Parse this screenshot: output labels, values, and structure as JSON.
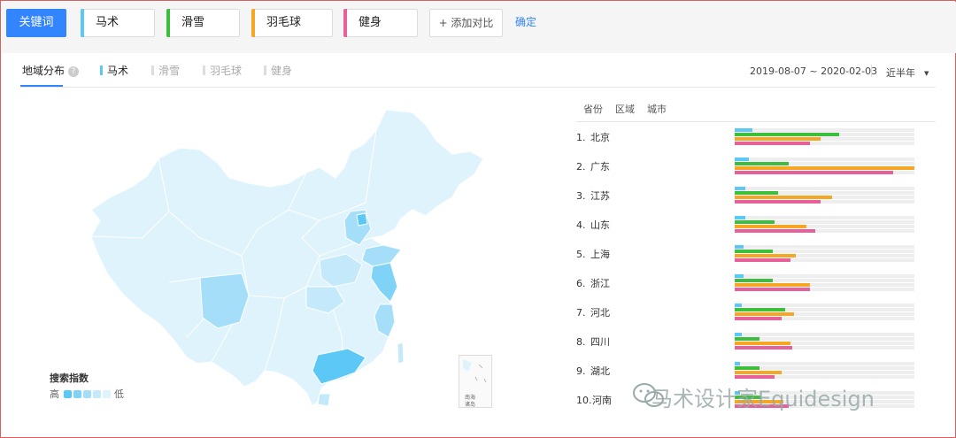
{
  "toolbar": {
    "keywords_label": "关键词",
    "keywords": [
      {
        "label": "马术",
        "color": "#5bc8f5"
      },
      {
        "label": "滑雪",
        "color": "#3cbf3c"
      },
      {
        "label": "羽毛球",
        "color": "#f5a623"
      },
      {
        "label": "健身",
        "color": "#e8609a"
      }
    ],
    "add_label": "+ 添加对比",
    "confirm_label": "确定"
  },
  "header": {
    "main_tab": "地域分布",
    "help_glyph": "?",
    "keyword_tabs": [
      {
        "label": "马术",
        "active": true,
        "color": "#5bc8f5"
      },
      {
        "label": "滑雪",
        "active": false
      },
      {
        "label": "羽毛球",
        "active": false
      },
      {
        "label": "健身",
        "active": false
      }
    ],
    "date_range": "2019-08-07 ~ 2020-02-03",
    "period": "近半年"
  },
  "map": {
    "legend_title": "搜索指数",
    "legend_high": "高",
    "legend_low": "低",
    "legend_colors": [
      "#5bc8f5",
      "#7fd3f7",
      "#a4def9",
      "#c4e9fb",
      "#dff3fd"
    ],
    "inset_label_top": "南海",
    "inset_label_bottom": "诸岛"
  },
  "ranking": {
    "tabs": [
      "省份",
      "区域",
      "城市"
    ],
    "series_colors": [
      "#5bc8f5",
      "#3cbf3c",
      "#f5a623",
      "#e8609a"
    ],
    "rows": [
      {
        "rank": "1.",
        "name": "北京",
        "values": [
          0.1,
          0.58,
          0.48,
          0.42
        ]
      },
      {
        "rank": "2.",
        "name": "广东",
        "values": [
          0.08,
          0.3,
          1.0,
          0.88
        ]
      },
      {
        "rank": "3.",
        "name": "江苏",
        "values": [
          0.06,
          0.24,
          0.54,
          0.48
        ]
      },
      {
        "rank": "4.",
        "name": "山东",
        "values": [
          0.06,
          0.22,
          0.4,
          0.45
        ]
      },
      {
        "rank": "5.",
        "name": "上海",
        "values": [
          0.05,
          0.21,
          0.34,
          0.31
        ]
      },
      {
        "rank": "6.",
        "name": "浙江",
        "values": [
          0.05,
          0.21,
          0.42,
          0.42
        ]
      },
      {
        "rank": "7.",
        "name": "河北",
        "values": [
          0.04,
          0.28,
          0.33,
          0.26
        ]
      },
      {
        "rank": "8.",
        "name": "四川",
        "values": [
          0.04,
          0.14,
          0.31,
          0.32
        ]
      },
      {
        "rank": "9.",
        "name": "湖北",
        "values": [
          0.03,
          0.14,
          0.26,
          0.22
        ]
      },
      {
        "rank": "10.",
        "name": "河南",
        "values": [
          0.03,
          0.15,
          0.27,
          0.3
        ]
      }
    ]
  },
  "watermark": {
    "text": "马术设计家Equidesign"
  }
}
